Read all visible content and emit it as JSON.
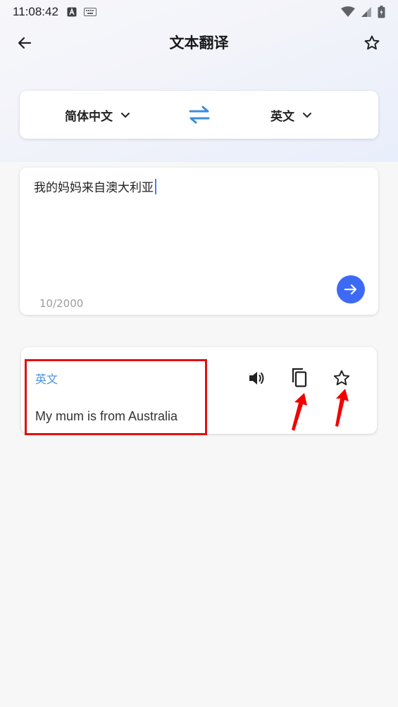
{
  "status_bar": {
    "time": "11:08:42"
  },
  "app_bar": {
    "title": "文本翻译"
  },
  "languages": {
    "source": "简体中文",
    "target": "英文"
  },
  "input": {
    "text": "我的妈妈来自澳大利亚",
    "char_count": "10/2000"
  },
  "result": {
    "language_label": "英文",
    "translation": "My mum is from Australia"
  },
  "icons": {
    "back": "arrow-left-icon",
    "favorite": "star-outline-icon",
    "swap": "swap-arrows-icon",
    "submit": "arrow-right-icon",
    "speak": "speaker-icon",
    "copy": "copy-icon",
    "result_favorite": "star-outline-icon"
  },
  "colors": {
    "accent": "#3d6af5",
    "swap": "#3b8ee0",
    "result_label": "#4a90e2",
    "annotation": "#e01010"
  }
}
